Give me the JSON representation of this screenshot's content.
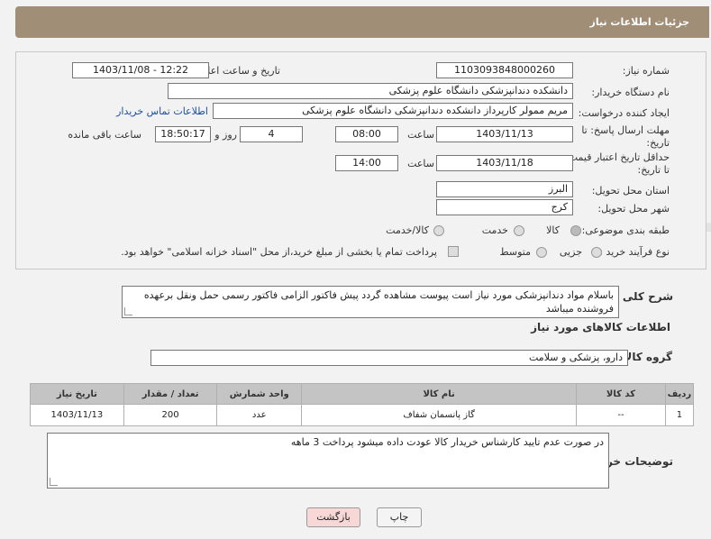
{
  "header": {
    "title": "جزئیات اطلاعات نیاز"
  },
  "form": {
    "need_number_label": "شماره نیاز:",
    "need_number": "1103093848000260",
    "announce_label": "تاریخ و ساعت اعلان عمومی:",
    "announce_value": "1403/11/08 - 12:22",
    "buyer_org_label": "نام دستگاه خریدار:",
    "buyer_org": "دانشکده دندانپزشکی دانشگاه علوم پزشکی",
    "creator_label": "ایجاد کننده درخواست:",
    "creator": "مریم ممولر کارپرداز دانشکده دندانپزشکی دانشگاه علوم پزشکی",
    "contact_link": "اطلاعات تماس خریدار",
    "deadline_label": "مهلت ارسال پاسخ: تا تاریخ:",
    "deadline_date": "1403/11/13",
    "time_label": "ساعت",
    "deadline_time": "08:00",
    "days_value": "4",
    "days_label": "روز و",
    "remaining_time": "18:50:17",
    "remaining_label": "ساعت باقی مانده",
    "validity_label": "حداقل تاریخ اعتبار قیمت: تا تاریخ:",
    "validity_date": "1403/11/18",
    "validity_time": "14:00",
    "province_label": "استان محل تحویل:",
    "province": "البرز",
    "city_label": "شهر محل تحویل:",
    "city": "کرج",
    "category_label": "طبقه بندی موضوعی:",
    "category_options": [
      "کالا",
      "خدمت",
      "کالا/خدمت"
    ],
    "process_label": "نوع فرآیند خرید :",
    "process_options": [
      "جزیی",
      "متوسط"
    ],
    "payment_note": "پرداخت تمام یا بخشی از مبلغ خرید،از محل \"اسناد خزانه اسلامی\" خواهد بود."
  },
  "description": {
    "label": "شرح کلی نیاز:",
    "text": "باسلام مواد دندانپزشکی مورد نیاز است پیوست مشاهده گردد پیش فاکتور الزامی فاکتور رسمی حمل ونقل برعهده فروشنده میباشد"
  },
  "goods": {
    "section_title": "اطلاعات کالاهای مورد نیاز",
    "group_label": "گروه کالا:",
    "group_value": "دارو، پزشکی و سلامت",
    "columns": [
      "ردیف",
      "کد کالا",
      "نام کالا",
      "واحد شمارش",
      "تعداد / مقدار",
      "تاریخ نیاز"
    ],
    "rows": [
      [
        "1",
        "--",
        "گاز پانسمان شفاف",
        "عدد",
        "200",
        "1403/11/13"
      ]
    ]
  },
  "buyer_notes": {
    "label": "توضیحات خریدار:",
    "text": "در صورت عدم تایید کارشناس خریدار کالا عودت داده میشود پرداخت 3 ماهه"
  },
  "buttons": {
    "print": "چاپ",
    "back": "بازگشت"
  },
  "watermark": "AriaTender.neT",
  "colors": {
    "header": "#a08e77",
    "link": "#1b4fa8",
    "back_button": "#f8d7d7"
  }
}
